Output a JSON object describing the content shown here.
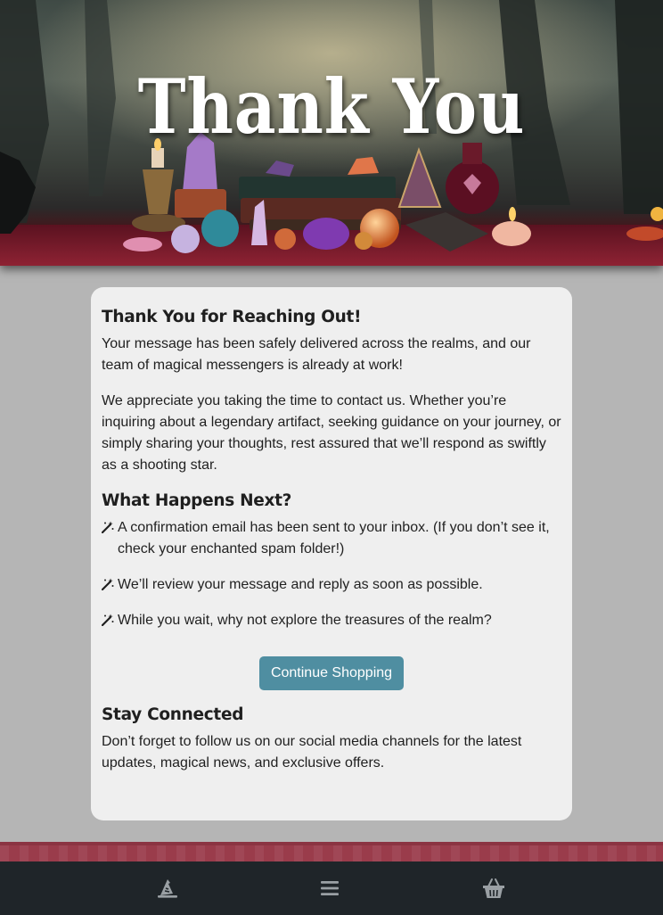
{
  "hero": {
    "title": "Thank You"
  },
  "card": {
    "heading_thanks": "Thank You for Reaching Out!",
    "intro": "Your message has been safely delivered across the realms, and our team of magical messengers is already at work!",
    "appreciation": "We appreciate you taking the time to contact us. Whether you’re inquiring about a legendary artifact, seeking guidance on your journey, or simply sharing your thoughts, rest assured that we’ll respond as swiftly as a shooting star.",
    "heading_next": "What Happens Next?",
    "steps": [
      {
        "icon": "magic-wand-icon",
        "text": "A confirmation email has been sent to your inbox. (If you don’t see it, check your enchanted spam folder!)"
      },
      {
        "icon": "magic-wand-icon",
        "text": "We’ll review your message and reply as soon as possible."
      },
      {
        "icon": "magic-wand-icon",
        "text": "While you wait, why not explore the treasures of the realm?"
      }
    ],
    "button_label": "Continue Shopping",
    "heading_connected": "Stay Connected",
    "connected_text": "Don’t forget to follow us on our social media channels for the latest updates, magical news, and exclusive offers."
  },
  "nav": {
    "items": [
      {
        "icon": "wizard-hat-icon"
      },
      {
        "icon": "menu-icon"
      },
      {
        "icon": "basket-icon"
      }
    ]
  },
  "colors": {
    "button": "#4f8ea1",
    "card": "#efefef",
    "page": "#b5b5b5",
    "strip": "#9a3c4b",
    "nav": "#1f2529"
  }
}
